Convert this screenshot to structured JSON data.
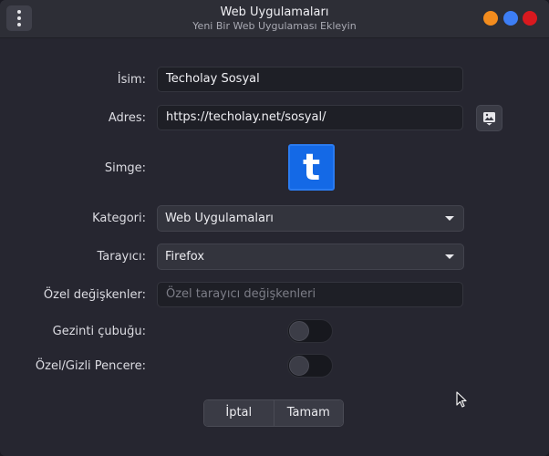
{
  "window": {
    "title": "Web Uygulamaları",
    "subtitle": "Yeni Bir Web Uygulaması Ekleyin"
  },
  "form": {
    "name_label": "İsim:",
    "name_value": "Techolay Sosyal",
    "address_label": "Adres:",
    "address_value": "https://techolay.net/sosyal/",
    "icon_label": "Simge:",
    "icon_letter": "t",
    "category_label": "Kategori:",
    "category_value": "Web Uygulamaları",
    "browser_label": "Tarayıcı:",
    "browser_value": "Firefox",
    "custom_vars_label": "Özel değişkenler:",
    "custom_vars_placeholder": "Özel tarayıcı değişkenleri",
    "navbar_label": "Gezinti çubuğu:",
    "navbar_enabled": false,
    "private_label": "Özel/Gizli Pencere:",
    "private_enabled": false
  },
  "buttons": {
    "cancel": "İptal",
    "ok": "Tamam"
  },
  "colors": {
    "minimize": "#f28c1e",
    "maximize": "#3d7ef5",
    "close": "#d9191f",
    "app_icon_bg": "#1469e6"
  },
  "icons": {
    "menu": "vertical-dots-icon",
    "favicon_fetch": "image-download-icon",
    "combo_arrow": "triangle-down-icon",
    "cursor": "mouse-pointer-icon"
  }
}
